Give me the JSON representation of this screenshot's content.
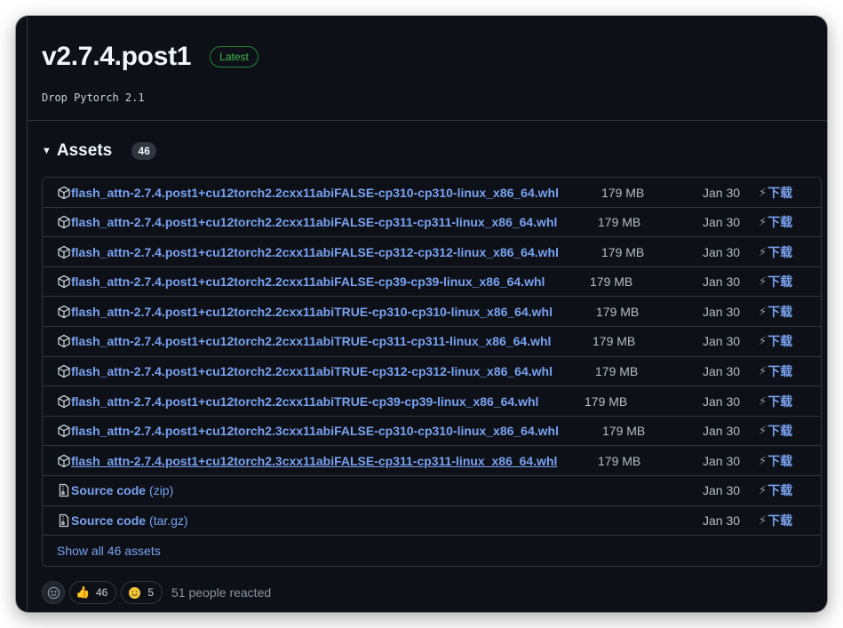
{
  "release": {
    "title": "v2.7.4.post1",
    "badge": "Latest",
    "description": "Drop Pytorch 2.1"
  },
  "assets": {
    "heading": "Assets",
    "count": "46",
    "download_label": "下载",
    "show_all": "Show all 46 assets",
    "items": [
      {
        "name": "flash_attn-2.7.4.post1+cu12torch2.2cxx11abiFALSE-cp310-cp310-linux_x86_64.whl",
        "size": "179 MB",
        "date": "Jan 30"
      },
      {
        "name": "flash_attn-2.7.4.post1+cu12torch2.2cxx11abiFALSE-cp311-cp311-linux_x86_64.whl",
        "size": "179 MB",
        "date": "Jan 30"
      },
      {
        "name": "flash_attn-2.7.4.post1+cu12torch2.2cxx11abiFALSE-cp312-cp312-linux_x86_64.whl",
        "size": "179 MB",
        "date": "Jan 30"
      },
      {
        "name": "flash_attn-2.7.4.post1+cu12torch2.2cxx11abiFALSE-cp39-cp39-linux_x86_64.whl",
        "size": "179 MB",
        "date": "Jan 30"
      },
      {
        "name": "flash_attn-2.7.4.post1+cu12torch2.2cxx11abiTRUE-cp310-cp310-linux_x86_64.whl",
        "size": "179 MB",
        "date": "Jan 30"
      },
      {
        "name": "flash_attn-2.7.4.post1+cu12torch2.2cxx11abiTRUE-cp311-cp311-linux_x86_64.whl",
        "size": "179 MB",
        "date": "Jan 30"
      },
      {
        "name": "flash_attn-2.7.4.post1+cu12torch2.2cxx11abiTRUE-cp312-cp312-linux_x86_64.whl",
        "size": "179 MB",
        "date": "Jan 30"
      },
      {
        "name": "flash_attn-2.7.4.post1+cu12torch2.2cxx11abiTRUE-cp39-cp39-linux_x86_64.whl",
        "size": "179 MB",
        "date": "Jan 30"
      },
      {
        "name": "flash_attn-2.7.4.post1+cu12torch2.3cxx11abiFALSE-cp310-cp310-linux_x86_64.whl",
        "size": "179 MB",
        "date": "Jan 30"
      },
      {
        "name": "flash_attn-2.7.4.post1+cu12torch2.3cxx11abiFALSE-cp311-cp311-linux_x86_64.whl",
        "size": "179 MB",
        "date": "Jan 30"
      }
    ],
    "source": [
      {
        "name": "Source code",
        "ext": "(zip)",
        "date": "Jan 30"
      },
      {
        "name": "Source code",
        "ext": "(tar.gz)",
        "date": "Jan 30"
      }
    ]
  },
  "reactions": {
    "thumbs_up_count": "46",
    "smile_count": "5",
    "summary": "51 people reacted"
  },
  "colors": {
    "background": "#0d1117",
    "link": "#79a2f2",
    "badge_green": "#3fb950",
    "border": "#30363d"
  }
}
